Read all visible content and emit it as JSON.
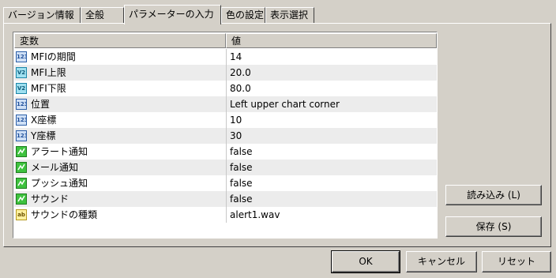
{
  "tabs": [
    "バージョン情報",
    "全般",
    "パラメーターの入力",
    "色の設定",
    "表示選択"
  ],
  "grid": {
    "col_variable": "変数",
    "col_value": "値",
    "rows": [
      {
        "icon": "int-icon",
        "icon_text": "123",
        "name": "MFIの期間",
        "value": "14"
      },
      {
        "icon": "double-icon",
        "icon_text": "V2",
        "name": "MFI上限",
        "value": "20.0"
      },
      {
        "icon": "double-icon",
        "icon_text": "V2",
        "name": "MFI下限",
        "value": "80.0"
      },
      {
        "icon": "int-icon",
        "icon_text": "123",
        "name": "位置",
        "value": "Left upper chart corner"
      },
      {
        "icon": "int-icon",
        "icon_text": "123",
        "name": "X座標",
        "value": "10"
      },
      {
        "icon": "int-icon",
        "icon_text": "123",
        "name": "Y座標",
        "value": "30"
      },
      {
        "icon": "bool-icon",
        "icon_text": "",
        "name": "アラート通知",
        "value": "false"
      },
      {
        "icon": "bool-icon",
        "icon_text": "",
        "name": "メール通知",
        "value": "false"
      },
      {
        "icon": "bool-icon",
        "icon_text": "",
        "name": "プッシュ通知",
        "value": "false"
      },
      {
        "icon": "bool-icon",
        "icon_text": "",
        "name": "サウンド",
        "value": "false"
      },
      {
        "icon": "string-icon",
        "icon_text": "ab",
        "name": "サウンドの種類",
        "value": "alert1.wav"
      }
    ]
  },
  "buttons": {
    "load": "読み込み (L)",
    "save": "保存 (S)",
    "ok": "OK",
    "cancel": "キャンセル",
    "reset": "リセット"
  }
}
